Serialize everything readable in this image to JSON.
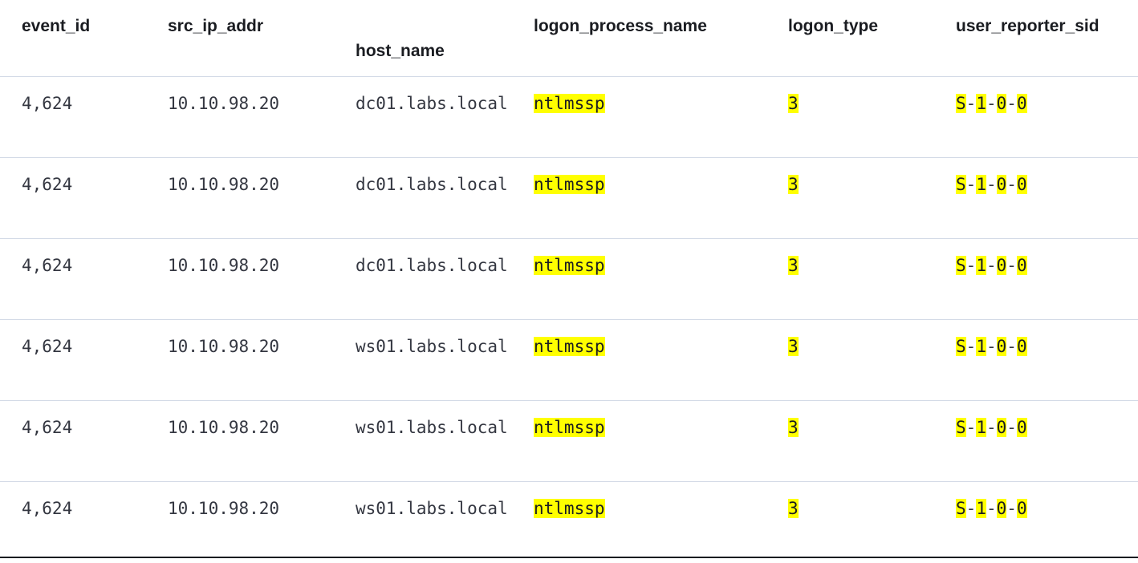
{
  "columns": [
    {
      "key": "event_id",
      "label": "event_id"
    },
    {
      "key": "src_ip_addr",
      "label": "src_ip_addr"
    },
    {
      "key": "host_name",
      "label": "host_name"
    },
    {
      "key": "logon_process_name",
      "label": "logon_process_name"
    },
    {
      "key": "logon_type",
      "label": "logon_type"
    },
    {
      "key": "user_reporter_sid",
      "label": "user_reporter_sid"
    }
  ],
  "rows": [
    {
      "event_id": "4,624",
      "src_ip_addr": "10.10.98.20",
      "host_name": "dc01.labs.local",
      "logon_process_name": "ntlmssp",
      "logon_type": "3",
      "user_reporter_sid": [
        "S",
        "1",
        "0",
        "0"
      ]
    },
    {
      "event_id": "4,624",
      "src_ip_addr": "10.10.98.20",
      "host_name": "dc01.labs.local",
      "logon_process_name": "ntlmssp",
      "logon_type": "3",
      "user_reporter_sid": [
        "S",
        "1",
        "0",
        "0"
      ]
    },
    {
      "event_id": "4,624",
      "src_ip_addr": "10.10.98.20",
      "host_name": "dc01.labs.local",
      "logon_process_name": "ntlmssp",
      "logon_type": "3",
      "user_reporter_sid": [
        "S",
        "1",
        "0",
        "0"
      ]
    },
    {
      "event_id": "4,624",
      "src_ip_addr": "10.10.98.20",
      "host_name": "ws01.labs.local",
      "logon_process_name": "ntlmssp",
      "logon_type": "3",
      "user_reporter_sid": [
        "S",
        "1",
        "0",
        "0"
      ]
    },
    {
      "event_id": "4,624",
      "src_ip_addr": "10.10.98.20",
      "host_name": "ws01.labs.local",
      "logon_process_name": "ntlmssp",
      "logon_type": "3",
      "user_reporter_sid": [
        "S",
        "1",
        "0",
        "0"
      ]
    },
    {
      "event_id": "4,624",
      "src_ip_addr": "10.10.98.20",
      "host_name": "ws01.labs.local",
      "logon_process_name": "ntlmssp",
      "logon_type": "3",
      "user_reporter_sid": [
        "S",
        "1",
        "0",
        "0"
      ]
    }
  ],
  "colors": {
    "highlight": "#ffff00",
    "text": "#343741",
    "header_text": "#1a1c21",
    "border": "#d3dae6"
  }
}
